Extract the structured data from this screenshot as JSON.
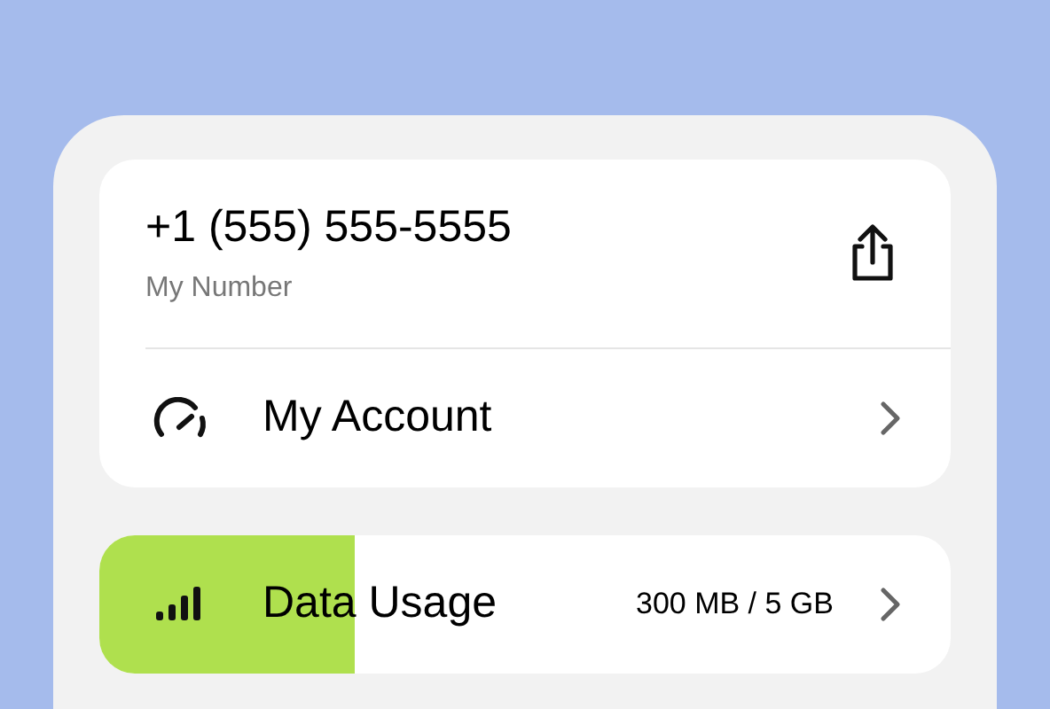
{
  "number_card": {
    "phone": "+1 (555) 555-5555",
    "label": "My Number"
  },
  "account_row": {
    "label": "My Account"
  },
  "data_usage": {
    "label": "Data Usage",
    "reading": "300 MB / 5 GB",
    "level": 0.3
  }
}
